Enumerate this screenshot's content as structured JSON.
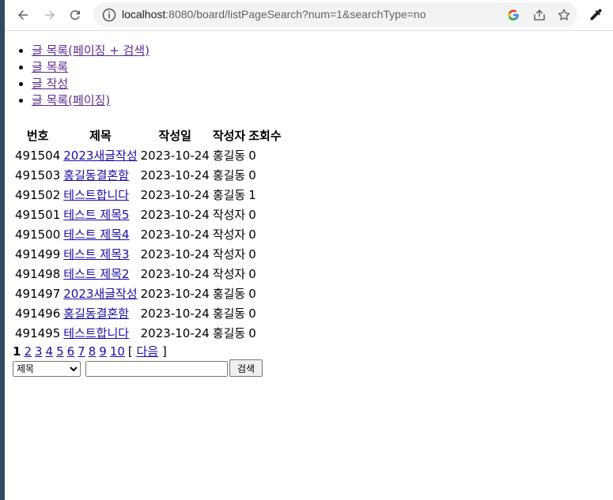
{
  "browser": {
    "url_host": "localhost",
    "url_path": ":8080/board/listPageSearch?num=1&searchType=no"
  },
  "menu": [
    "글 목록(페이징 + 검색)",
    "글 목록",
    "글 작성",
    "글 목록(페이징)"
  ],
  "table": {
    "headers": [
      "번호",
      "제목",
      "작성일",
      "작성자",
      "조회수"
    ],
    "rows": [
      {
        "no": "491504",
        "title": "2023새글작성",
        "date": "2023-10-24",
        "writer": "홍길동",
        "views": "0"
      },
      {
        "no": "491503",
        "title": "홍길동결혼함",
        "date": "2023-10-24",
        "writer": "홍길동",
        "views": "0"
      },
      {
        "no": "491502",
        "title": "테스트합니다",
        "date": "2023-10-24",
        "writer": "홍길동",
        "views": "1"
      },
      {
        "no": "491501",
        "title": "테스트 제목5",
        "date": "2023-10-24",
        "writer": "작성자",
        "views": "0"
      },
      {
        "no": "491500",
        "title": "테스트 제목4",
        "date": "2023-10-24",
        "writer": "작성자",
        "views": "0"
      },
      {
        "no": "491499",
        "title": "테스트 제목3",
        "date": "2023-10-24",
        "writer": "작성자",
        "views": "0"
      },
      {
        "no": "491498",
        "title": "테스트 제목2",
        "date": "2023-10-24",
        "writer": "작성자",
        "views": "0"
      },
      {
        "no": "491497",
        "title": "2023새글작성",
        "date": "2023-10-24",
        "writer": "홍길동",
        "views": "0"
      },
      {
        "no": "491496",
        "title": "홍길동결혼함",
        "date": "2023-10-24",
        "writer": "홍길동",
        "views": "0"
      },
      {
        "no": "491495",
        "title": "테스트합니다",
        "date": "2023-10-24",
        "writer": "홍길동",
        "views": "0"
      }
    ]
  },
  "pager": {
    "current": "1",
    "pages": [
      "2",
      "3",
      "4",
      "5",
      "6",
      "7",
      "8",
      "9",
      "10"
    ],
    "bracket_open": "[",
    "next": "다음",
    "bracket_close": "]"
  },
  "search": {
    "type_selected": "제목",
    "keyword": "",
    "button": "검색"
  },
  "colors": {
    "link": "#1a0dab",
    "visited": "#5b2d8e"
  }
}
